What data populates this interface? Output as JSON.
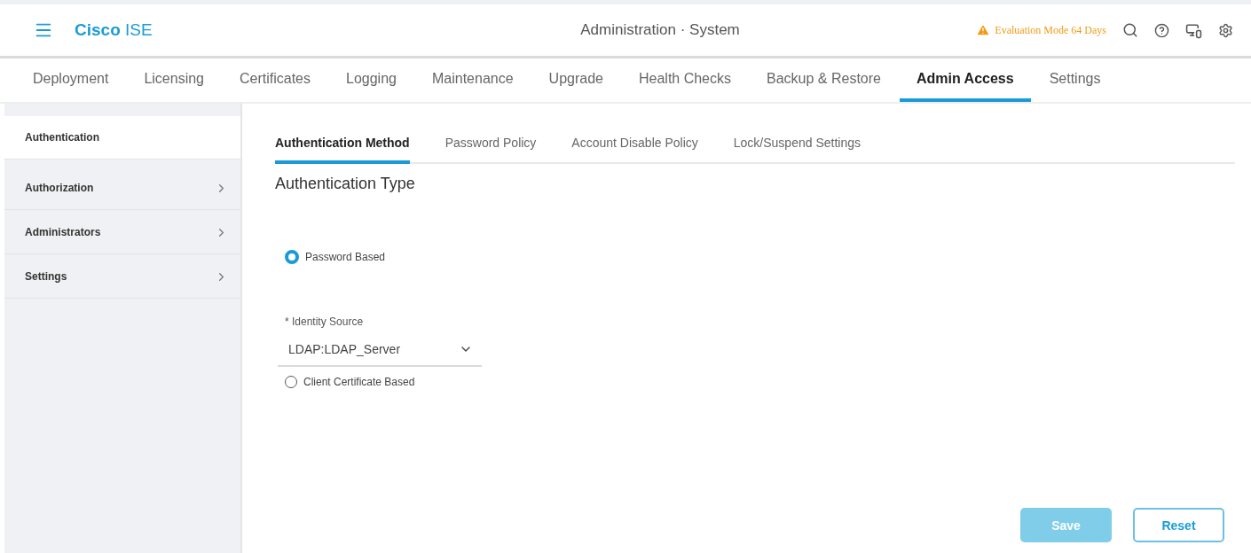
{
  "header": {
    "brand_bold": "Cisco",
    "brand_light": "ISE",
    "title": "Administration · System",
    "warning": "Evaluation Mode 64 Days"
  },
  "nav_tabs": [
    {
      "label": "Deployment",
      "selected": false
    },
    {
      "label": "Licensing",
      "selected": false
    },
    {
      "label": "Certificates",
      "selected": false
    },
    {
      "label": "Logging",
      "selected": false
    },
    {
      "label": "Maintenance",
      "selected": false
    },
    {
      "label": "Upgrade",
      "selected": false
    },
    {
      "label": "Health Checks",
      "selected": false
    },
    {
      "label": "Backup & Restore",
      "selected": false
    },
    {
      "label": "Admin Access",
      "selected": true
    },
    {
      "label": "Settings",
      "selected": false
    }
  ],
  "sidebar": {
    "items": [
      {
        "label": "Authentication",
        "selected": true,
        "expandable": false
      },
      {
        "label": "Authorization",
        "selected": false,
        "expandable": true
      },
      {
        "label": "Administrators",
        "selected": false,
        "expandable": true
      },
      {
        "label": "Settings",
        "selected": false,
        "expandable": true
      }
    ]
  },
  "sub_tabs": [
    {
      "label": "Authentication Method",
      "selected": true
    },
    {
      "label": "Password Policy",
      "selected": false
    },
    {
      "label": "Account Disable Policy",
      "selected": false
    },
    {
      "label": "Lock/Suspend Settings",
      "selected": false
    }
  ],
  "section_title": "Authentication Type",
  "options": [
    {
      "label": "Password Based",
      "selected": true
    },
    {
      "label": "Client Certificate Based",
      "selected": false
    }
  ],
  "identity_source": {
    "label": "* Identity Source",
    "value": "LDAP:LDAP_Server"
  },
  "buttons": [
    {
      "label": "Save",
      "kind": "primary",
      "disabled": true
    },
    {
      "label": "Reset",
      "kind": "secondary",
      "disabled": false
    }
  ]
}
